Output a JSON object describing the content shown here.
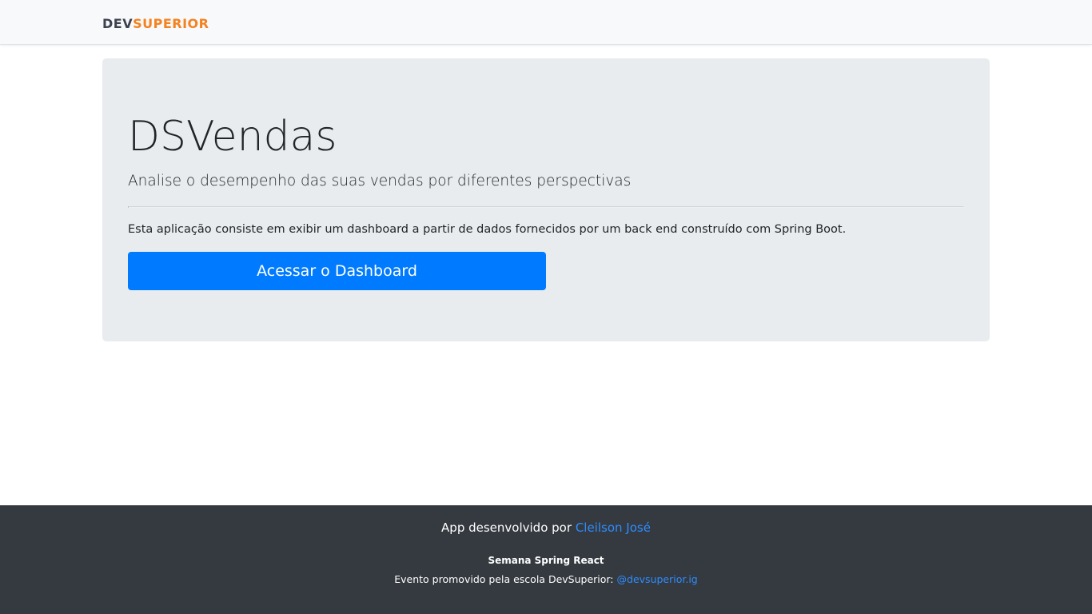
{
  "navbar": {
    "logo_part1": "DEV",
    "logo_part2": "SUPERIOR"
  },
  "hero": {
    "title": "DSVendas",
    "lead": "Analise o desempenho das suas vendas por diferentes perspectivas",
    "description": "Esta aplicação consiste em exibir um dashboard a partir de dados fornecidos por um back end construído com Spring Boot.",
    "button_label": "Acessar o Dashboard"
  },
  "footer": {
    "dev_prefix": "App desenvolvido por",
    "dev_name": "Cleilson José",
    "event_title": "Semana Spring React",
    "event_prefix": "Evento promovido pela escola DevSuperior:",
    "event_handle": "@devsuperior.ig"
  },
  "colors": {
    "navbar_bg": "#f8f9fa",
    "jumbotron_bg": "#e9ecef",
    "primary": "#007bff",
    "logo_dark": "#3d4250",
    "logo_orange": "#f58220",
    "footer_bg": "#343a40",
    "link": "#2f8cff"
  }
}
